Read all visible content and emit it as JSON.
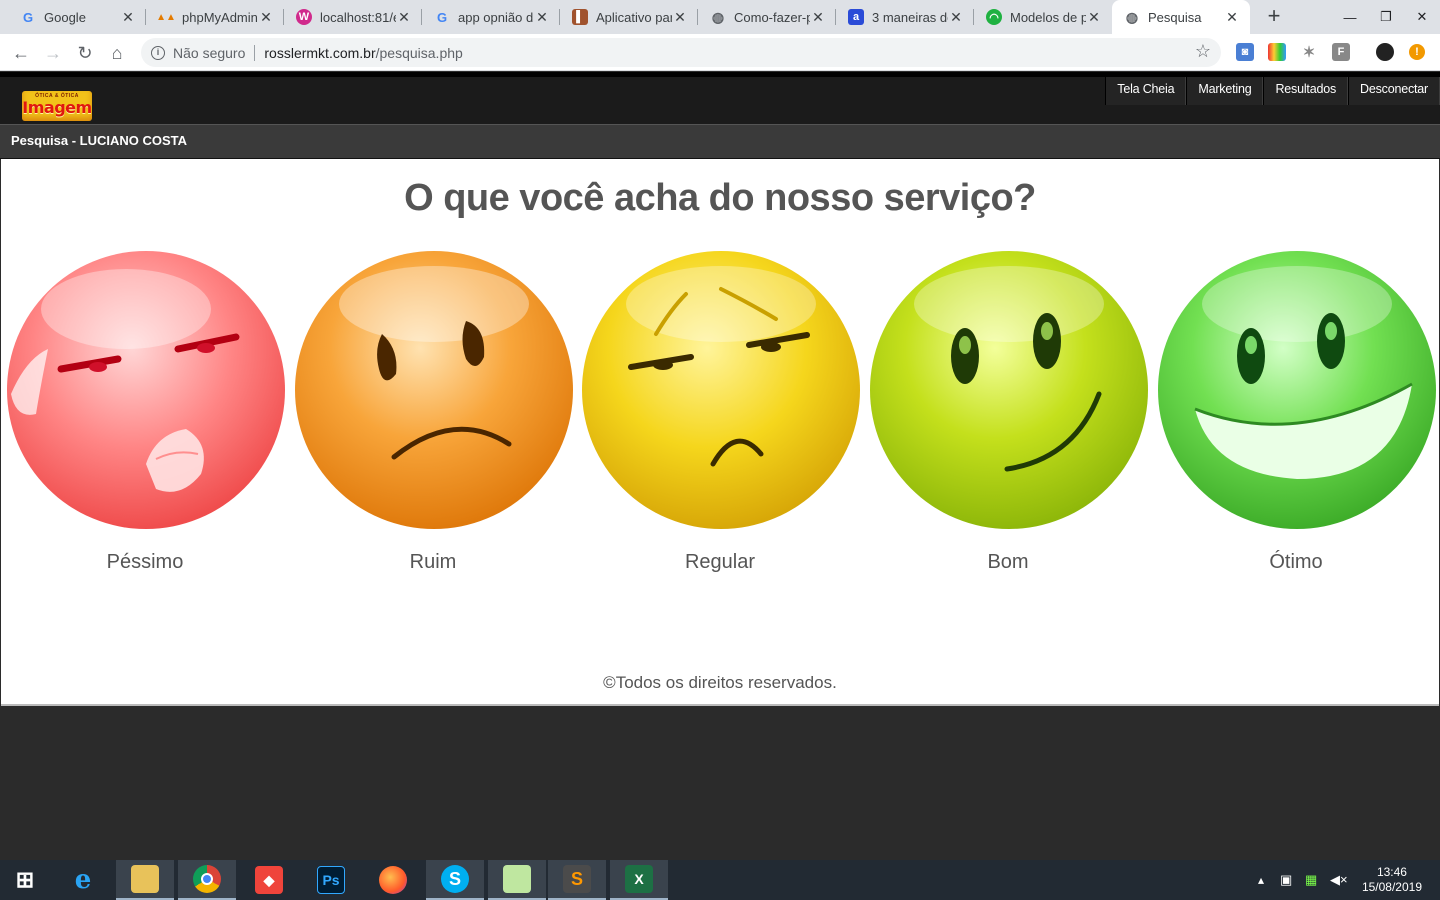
{
  "browser": {
    "tabs": [
      {
        "title": "Google",
        "favicon": "google-icon"
      },
      {
        "title": "phpMyAdmin",
        "favicon": "phpmyadmin-icon"
      },
      {
        "title": "localhost:81/e",
        "favicon": "localhost-icon"
      },
      {
        "title": "app opnião d",
        "favicon": "google-icon"
      },
      {
        "title": "Aplicativo par",
        "favicon": "book-icon"
      },
      {
        "title": "Como-fazer-p",
        "favicon": "globe-icon"
      },
      {
        "title": "3 maneiras de",
        "favicon": "a-icon"
      },
      {
        "title": "Modelos de p",
        "favicon": "green-circle-icon"
      },
      {
        "title": "Pesquisa",
        "favicon": "globe-icon",
        "active": true
      }
    ],
    "security_label": "Não seguro",
    "url_host": "rosslermkt.com.br",
    "url_path": "/pesquisa.php"
  },
  "site": {
    "logo_small": "ÓTICA & ÓTICA",
    "logo_text": "Imagem",
    "nav": {
      "full_screen": "Tela Cheia",
      "marketing": "Marketing",
      "results": "Resultados",
      "logout": "Desconectar"
    },
    "subheader": "Pesquisa - LUCIANO COSTA"
  },
  "survey": {
    "question": "O que você acha do nosso serviço?",
    "options": [
      {
        "label": "Péssimo",
        "color": "#f05a5a"
      },
      {
        "label": "Ruim",
        "color": "#f0951e"
      },
      {
        "label": "Regular",
        "color": "#e8c80a"
      },
      {
        "label": "Bom",
        "color": "#b8dc14"
      },
      {
        "label": "Ótimo",
        "color": "#5cd43c"
      }
    ],
    "footer": "©Todos os direitos reservados."
  },
  "taskbar": {
    "time": "13:46",
    "date": "15/08/2019"
  }
}
